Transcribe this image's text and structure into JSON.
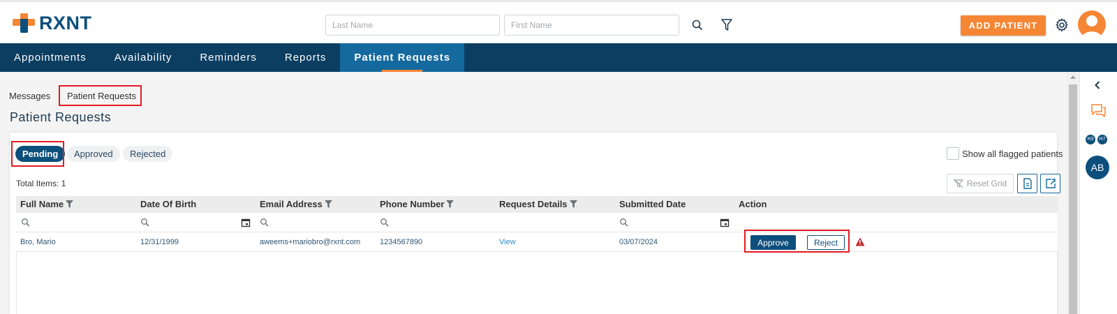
{
  "brand": {
    "name": "RXNT",
    "primary_color": "#0d4f7c",
    "accent_color": "#f58634"
  },
  "header": {
    "last_name_placeholder": "Last Name",
    "first_name_placeholder": "First Name",
    "search_icon": "search-icon",
    "filter_icon": "filter-icon",
    "add_patient_label": "ADD PATIENT",
    "settings_icon": "gear-icon",
    "avatar_icon": "user-avatar-icon"
  },
  "nav": {
    "items": [
      {
        "label": "Appointments",
        "active": false
      },
      {
        "label": "Availability",
        "active": false
      },
      {
        "label": "Reminders",
        "active": false
      },
      {
        "label": "Reports",
        "active": false
      },
      {
        "label": "Patient Requests",
        "active": true
      }
    ]
  },
  "subtabs": [
    {
      "label": "Messages"
    },
    {
      "label": "Patient Requests",
      "highlighted": true
    }
  ],
  "page": {
    "title": "Patient Requests"
  },
  "status_filters": [
    {
      "label": "Pending",
      "active": true
    },
    {
      "label": "Approved",
      "active": false
    },
    {
      "label": "Rejected",
      "active": false
    }
  ],
  "show_flagged": {
    "label": "Show all flagged patients",
    "checked": false
  },
  "toolbar": {
    "total_items": "Total Items: 1",
    "reset_grid": "Reset Grid"
  },
  "grid": {
    "columns": [
      {
        "label": "Full Name",
        "filter": true
      },
      {
        "label": "Date Of Birth",
        "filter": false
      },
      {
        "label": "Email Address",
        "filter": true
      },
      {
        "label": "Phone Number",
        "filter": true
      },
      {
        "label": "Request Details",
        "filter": true
      },
      {
        "label": "Submitted Date",
        "filter": false
      },
      {
        "label": "Action",
        "filter": false
      }
    ],
    "rows": [
      {
        "full_name": "Bro, Mario",
        "dob": "12/31/1999",
        "email": "aweems+mariobro@rxnt.com",
        "phone": "1234567890",
        "details": "View",
        "submitted": "03/07/2024",
        "approve_label": "Approve",
        "reject_label": "Reject",
        "warning_icon": "warning-icon"
      }
    ]
  },
  "right_rail": {
    "collapse_icon": "chevron-left-icon",
    "chat_icon": "chat-icon",
    "badges": [
      "H3",
      "H7"
    ],
    "user_initials": "AB"
  }
}
